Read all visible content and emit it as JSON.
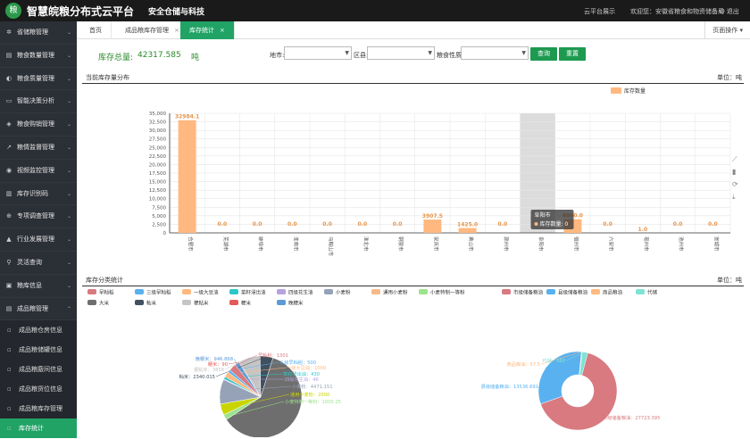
{
  "header": {
    "logo": "粮",
    "brand": "智慧皖粮分布式云平台",
    "slogan": "安全仓储与科技",
    "cloud": "云平台展示",
    "welcome": "欢迎您：安徽省粮食和物资储备局",
    "logout": "退出"
  },
  "sidebar": {
    "items": [
      {
        "label": "省储粮管理",
        "icon": "✲"
      },
      {
        "label": "粮食数量管理",
        "icon": "▤"
      },
      {
        "label": "粮食质量管理",
        "icon": "◐"
      },
      {
        "label": "智能决策分析",
        "icon": "▭"
      },
      {
        "label": "粮食购销管理",
        "icon": "◈"
      },
      {
        "label": "粮情监督管理",
        "icon": "↗"
      },
      {
        "label": "视频监控管理",
        "icon": "◉"
      },
      {
        "label": "库存识别码",
        "icon": "▥"
      },
      {
        "label": "专项调查管理",
        "icon": "⊕"
      },
      {
        "label": "行业发展管理",
        "icon": "▲"
      },
      {
        "label": "灵活查询",
        "icon": "⚲"
      },
      {
        "label": "粮库信息",
        "icon": "▣"
      },
      {
        "label": "成品粮管理",
        "icon": "▤"
      }
    ],
    "subitems": [
      {
        "label": "成品粮仓房信息"
      },
      {
        "label": "成品粮储罐信息"
      },
      {
        "label": "成品粮廒间信息"
      },
      {
        "label": "成品粮货位信息"
      },
      {
        "label": "成品粮库存管理"
      },
      {
        "label": "库存统计"
      }
    ]
  },
  "tabs": [
    {
      "label": "首页",
      "close": ""
    },
    {
      "label": "成品粮库存管理",
      "close": "×"
    },
    {
      "label": "库存统计",
      "close": "×"
    }
  ],
  "page_ops": "页面操作 ▾",
  "filter": {
    "total_label": "库存总量:",
    "total_value": "42317.585",
    "total_unit": "吨",
    "city_label": "地市:",
    "district_label": "区县:",
    "nature_label": "粮食性质:",
    "query_button": "查询",
    "reset_button": "重置"
  },
  "bar_section": {
    "title": "当前库存量分布",
    "unit": "单位：吨"
  },
  "pie_section": {
    "title": "库存分类统计",
    "unit": "单位：吨"
  },
  "toolbox_icons": [
    "line-icon",
    "bar-icon",
    "restore-icon",
    "save-icon"
  ],
  "chart_data": [
    {
      "type": "bar",
      "legend": [
        "库存数量"
      ],
      "categories": [
        "合肥市",
        "芜湖市",
        "蚌埠市",
        "淮南市",
        "马鞍山市",
        "淮北市",
        "铜陵市",
        "安庆市",
        "黄山市",
        "滁州市",
        "阜阳市",
        "宿州市",
        "六安市",
        "亳州市",
        "池州市",
        "宣城市"
      ],
      "series": [
        {
          "name": "库存数量",
          "values": [
            32984.1,
            0,
            0,
            0,
            0,
            0,
            0,
            3907.5,
            1425.0,
            0,
            0,
            4000.0,
            0,
            1.0,
            0,
            0
          ]
        }
      ],
      "labels": [
        "32984.1",
        "0.0",
        "0.0",
        "0.0",
        "0.0",
        "0.0",
        "0.0",
        "3907.5",
        "1425.0",
        "0.0",
        "",
        "4000.0",
        "0.0",
        "1.0",
        "0.0",
        "0.0"
      ],
      "yticks": [
        "0",
        "2,500",
        "5,000",
        "7,500",
        "10,000",
        "12,500",
        "15,000",
        "17,500",
        "20,000",
        "22,500",
        "25,000",
        "27,500",
        "30,000",
        "32,500",
        "35,000"
      ],
      "ylim": [
        0,
        35000
      ],
      "highlight_index": 10,
      "tooltip": {
        "title": "阜阳市",
        "text": "库存数量: 0"
      },
      "color": "#ffb980"
    },
    {
      "type": "pie",
      "title": "品种",
      "legend": [
        {
          "name": "早籼稻",
          "color": "#d87a80"
        },
        {
          "name": "三级早籼稻",
          "color": "#5ab1ef"
        },
        {
          "name": "一级大豆油",
          "color": "#ffb980"
        },
        {
          "name": "菜籽浸出油",
          "color": "#2ec7c9"
        },
        {
          "name": "四级花生油",
          "color": "#b6a2de"
        },
        {
          "name": "小麦粉",
          "color": "#95a2b8"
        },
        {
          "name": "通用小麦粉",
          "color": "#f7b98a"
        },
        {
          "name": "小麦特制一等粉",
          "color": "#9ee38e"
        },
        {
          "name": "大米",
          "color": "#6e6e6e"
        },
        {
          "name": "籼米",
          "color": "#41505e"
        },
        {
          "name": "梗粘米",
          "color": "#c5c5c5"
        },
        {
          "name": "粳米",
          "color": "#e45a5a"
        },
        {
          "name": "晚粳米",
          "color": "#5b9bd5"
        }
      ],
      "slices": [
        {
          "label": "晚粳米：946.868",
          "value": 946.868,
          "color": "#5b9bd5"
        },
        {
          "label": "粳米：90",
          "value": 90,
          "color": "#e45a5a"
        },
        {
          "label": "梗粘米：3858",
          "value": 3858,
          "color": "#c5c5c5"
        },
        {
          "label": "籼米：2340.015",
          "value": 2340.015,
          "color": "#41505e"
        },
        {
          "label": "大米",
          "value": 28000,
          "color": "#6e6e6e"
        },
        {
          "label": "小麦特制一等粉：1000.25",
          "value": 1000.25,
          "color": "#9ee38e"
        },
        {
          "label": "通用小麦粉：2000",
          "value": 2000,
          "color": "#c9d400"
        },
        {
          "label": "小麦粉：4471.151",
          "value": 4471.151,
          "color": "#95a2b8"
        },
        {
          "label": "四级花生油：46",
          "value": 46,
          "color": "#b6a2de"
        },
        {
          "label": "菜籽浸出油：430",
          "value": 430,
          "color": "#2ec7c9"
        },
        {
          "label": "一级大豆油：1000",
          "value": 1000,
          "color": "#ffb980"
        },
        {
          "label": "三级早籼稻：500",
          "value": 500,
          "color": "#5ab1ef"
        },
        {
          "label": "早籼稻：1301",
          "value": 1301,
          "color": "#d87a80"
        }
      ]
    },
    {
      "type": "pie",
      "title": "性质",
      "legend": [
        {
          "name": "市级储备粮油",
          "color": "#d87a80"
        },
        {
          "name": "县级储备粮油",
          "color": "#5ab1ef"
        },
        {
          "name": "商品粮油",
          "color": "#ffb980"
        },
        {
          "name": "代储",
          "color": "#7fe3d4"
        }
      ],
      "slices": [
        {
          "label": "市级储备粮油：27723.395",
          "value": 27723.395,
          "color": "#d87a80"
        },
        {
          "label": "县级储备粮油：13536.691",
          "value": 13536.691,
          "color": "#5ab1ef"
        },
        {
          "label": "商品粮油：57.5",
          "value": 57.5,
          "color": "#ffb980"
        },
        {
          "label": "代储：980",
          "value": 980,
          "color": "#7fe3d4"
        }
      ]
    }
  ]
}
